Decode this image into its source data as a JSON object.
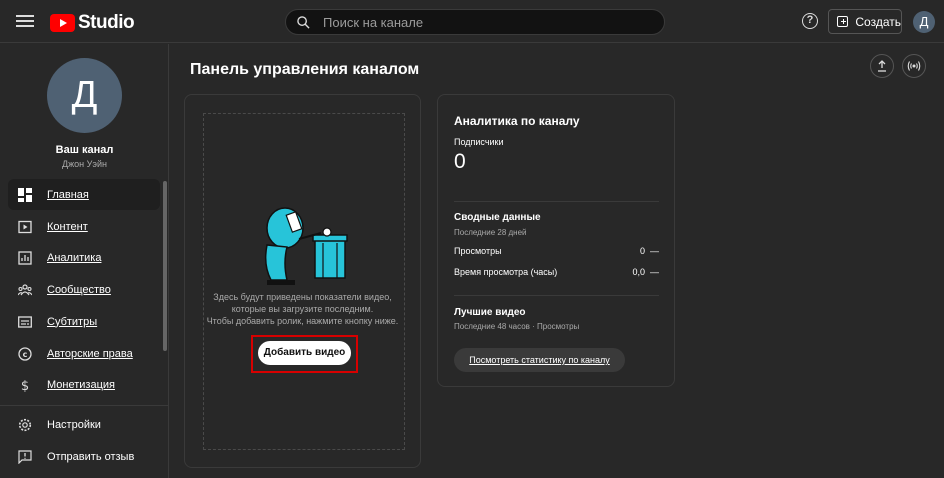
{
  "header": {
    "logo_text": "Studio",
    "search_placeholder": "Поиск на канале",
    "help_label": "?",
    "create_label": "Создать",
    "avatar_letter": "Д"
  },
  "sidebar": {
    "avatar_letter": "Д",
    "channel_name": "Ваш канал",
    "channel_owner": "Джон Уэйн",
    "items": [
      {
        "label": "Главная",
        "icon": "dashboard-icon"
      },
      {
        "label": "Контент",
        "icon": "content-icon"
      },
      {
        "label": "Аналитика",
        "icon": "analytics-icon"
      },
      {
        "label": "Сообщество",
        "icon": "community-icon"
      },
      {
        "label": "Субтитры",
        "icon": "subtitles-icon"
      },
      {
        "label": "Авторские права",
        "icon": "copyright-icon"
      },
      {
        "label": "Монетизация",
        "icon": "monetization-icon"
      }
    ],
    "bottom_items": [
      {
        "label": "Настройки",
        "icon": "settings-icon"
      },
      {
        "label": "Отправить отзыв",
        "icon": "feedback-icon"
      }
    ]
  },
  "main": {
    "title": "Панель управления каналом",
    "upload_card": {
      "empty_line1": "Здесь будут приведены показатели видео,",
      "empty_line2": "которые вы загрузите последним.",
      "empty_line3": "Чтобы добавить ролик, нажмите кнопку ниже.",
      "button_label": "Добавить видео"
    },
    "analytics_card": {
      "title": "Аналитика по каналу",
      "subscribers_label": "Подписчики",
      "subscribers_count": "0",
      "summary_title": "Сводные данные",
      "summary_period": "Последние 28 дней",
      "rows": [
        {
          "label": "Просмотры",
          "value": "0",
          "trend": "—"
        },
        {
          "label": "Время просмотра (часы)",
          "value": "0,0",
          "trend": "—"
        }
      ],
      "top_title": "Лучшие видео",
      "top_period": "Последние 48 часов · Просмотры",
      "stats_button": "Посмотреть статистику по каналу"
    }
  },
  "colors": {
    "background": "#282828",
    "accent_red": "#ff0000",
    "highlight_red": "#d70000",
    "illustration_cyan": "#27c4d9",
    "avatar": "#4f6173"
  }
}
